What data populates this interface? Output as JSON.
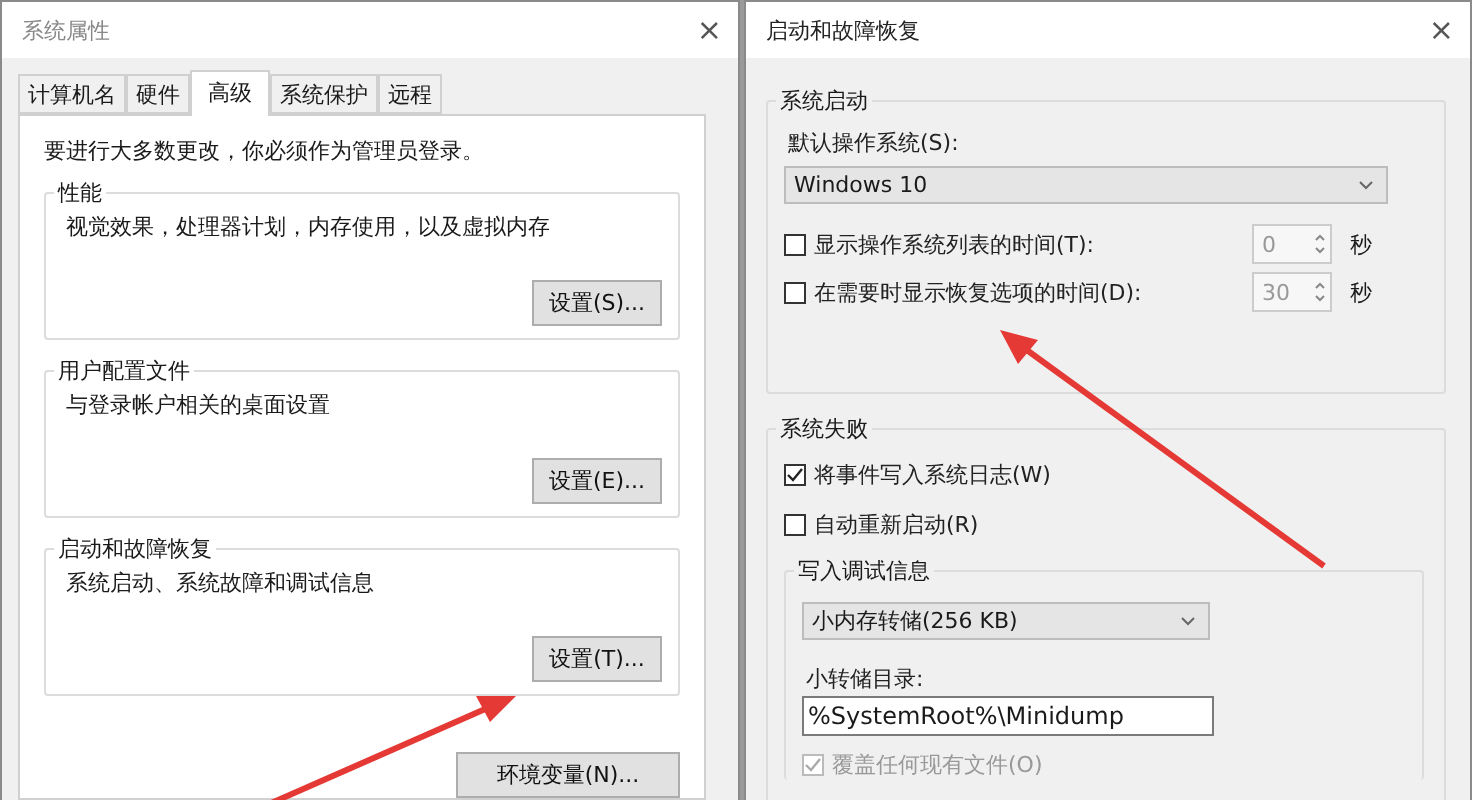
{
  "left_window": {
    "title": "系统属性",
    "close": "×",
    "tabs": [
      {
        "label": "计算机名",
        "selected": false
      },
      {
        "label": "硬件",
        "selected": false
      },
      {
        "label": "高级",
        "selected": true
      },
      {
        "label": "系统保护",
        "selected": false
      },
      {
        "label": "远程",
        "selected": false
      }
    ],
    "notice": "要进行大多数更改，你必须作为管理员登录。",
    "groups": [
      {
        "title": "性能",
        "description": "视觉效果，处理器计划，内存使用，以及虚拟内存",
        "button": "设置(S)..."
      },
      {
        "title": "用户配置文件",
        "description": "与登录帐户相关的桌面设置",
        "button": "设置(E)..."
      },
      {
        "title": "启动和故障恢复",
        "description": "系统启动、系统故障和调试信息",
        "button": "设置(T)..."
      }
    ],
    "footer_button": "环境变量(N)..."
  },
  "right_window": {
    "title": "启动和故障恢复",
    "close": "×",
    "system_startup": {
      "title": "系统启动",
      "default_os_label": "默认操作系统(S):",
      "default_os": "Windows 10",
      "timers": [
        {
          "label": "显示操作系统列表的时间(T):",
          "checked": false,
          "value": "0",
          "unit": "秒"
        },
        {
          "label": "在需要时显示恢复选项的时间(D):",
          "checked": false,
          "value": "30",
          "unit": "秒"
        }
      ]
    },
    "system_failure": {
      "title": "系统失败",
      "options": [
        {
          "label": "将事件写入系统日志(W)",
          "checked": true
        },
        {
          "label": "自动重新启动(R)",
          "checked": false
        }
      ],
      "debug": {
        "title": "写入调试信息",
        "dump_type": "小内存转储(256 KB)",
        "dir_label": "小转储目录:",
        "dir_value": "%SystemRoot%\\Minidump",
        "overwrite": {
          "label": "覆盖任何现有文件(O)",
          "checked": true,
          "disabled": true
        }
      }
    }
  }
}
